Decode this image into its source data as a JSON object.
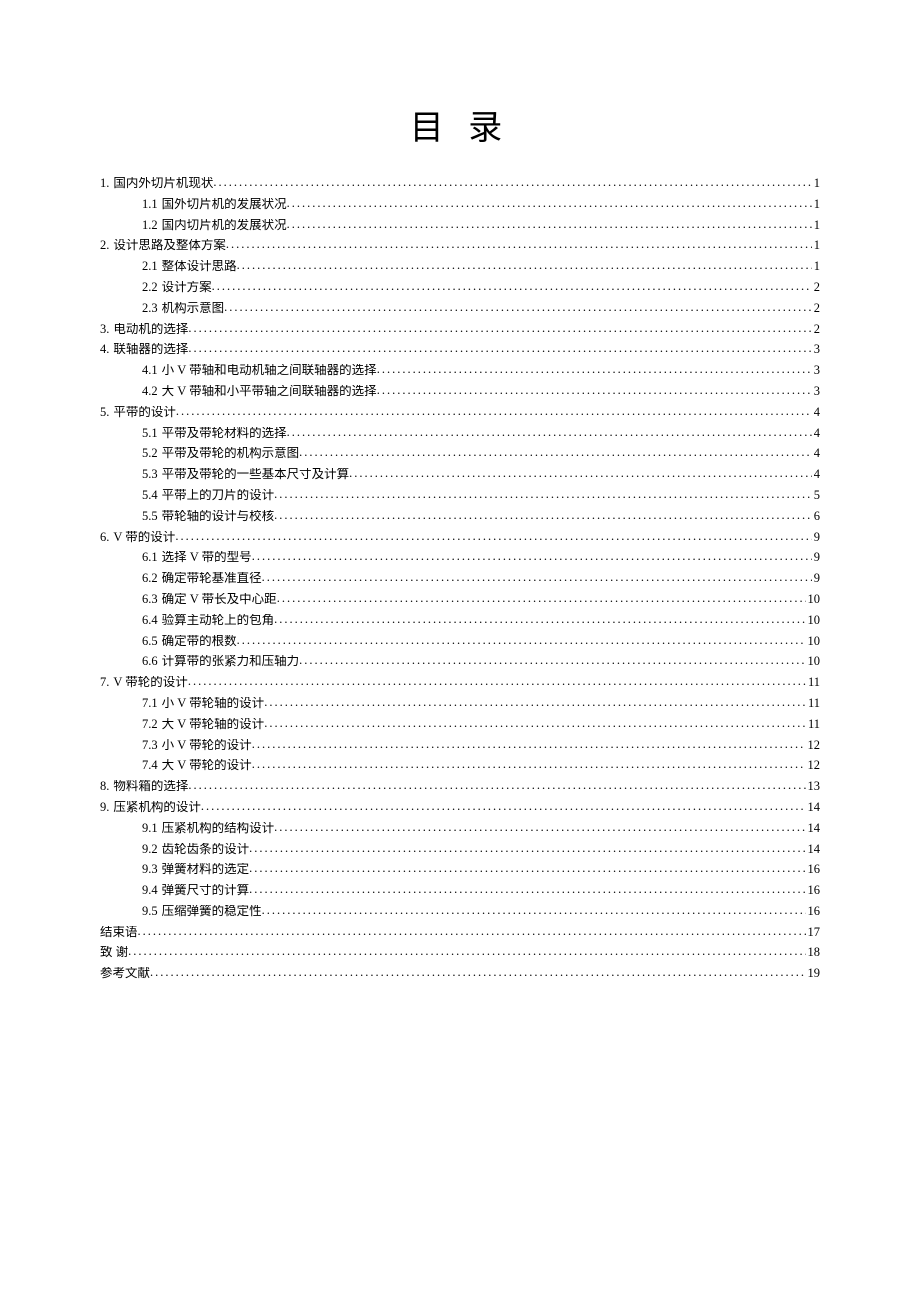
{
  "title": "目 录",
  "toc": [
    {
      "level": 1,
      "num": "1.",
      "text": "国内外切片机现状",
      "page": "1"
    },
    {
      "level": 2,
      "num": "1.1",
      "text": "国外切片机的发展状况",
      "page": "1"
    },
    {
      "level": 2,
      "num": "1.2",
      "text": "国内切片机的发展状况",
      "page": "1"
    },
    {
      "level": 1,
      "num": "2.",
      "text": "设计思路及整体方案",
      "page": "1"
    },
    {
      "level": 2,
      "num": "2.1",
      "text": "整体设计思路",
      "page": "1"
    },
    {
      "level": 2,
      "num": "2.2",
      "text": "设计方案",
      "page": "2"
    },
    {
      "level": 2,
      "num": "2.3",
      "text": "机构示意图",
      "page": "2"
    },
    {
      "level": 1,
      "num": "3.",
      "text": "电动机的选择",
      "page": "2"
    },
    {
      "level": 1,
      "num": "4.",
      "text": "联轴器的选择",
      "page": "3"
    },
    {
      "level": 2,
      "num": "4.1",
      "text": "小 V 带轴和电动机轴之间联轴器的选择",
      "page": "3"
    },
    {
      "level": 2,
      "num": "4.2",
      "text": "大 V 带轴和小平带轴之间联轴器的选择",
      "page": "3"
    },
    {
      "level": 1,
      "num": "5.",
      "text": "平带的设计",
      "page": "4"
    },
    {
      "level": 2,
      "num": "5.1",
      "text": "平带及带轮材料的选择",
      "page": "4"
    },
    {
      "level": 2,
      "num": "5.2",
      "text": "平带及带轮的机构示意图",
      "page": "4"
    },
    {
      "level": 2,
      "num": "5.3",
      "text": "平带及带轮的一些基本尺寸及计算",
      "page": "4"
    },
    {
      "level": 2,
      "num": "5.4",
      "text": "平带上的刀片的设计",
      "page": "5"
    },
    {
      "level": 2,
      "num": "5.5",
      "text": "带轮轴的设计与校核",
      "page": "6"
    },
    {
      "level": 1,
      "num": "6.",
      "text": "V 带的设计",
      "page": "9"
    },
    {
      "level": 2,
      "num": "6.1",
      "text": "选择 V 带的型号",
      "page": "9"
    },
    {
      "level": 2,
      "num": "6.2",
      "text": "确定带轮基准直径",
      "page": "9"
    },
    {
      "level": 2,
      "num": "6.3",
      "text": "确定 V 带长及中心距",
      "page": "10"
    },
    {
      "level": 2,
      "num": "6.4",
      "text": "验算主动轮上的包角",
      "page": "10"
    },
    {
      "level": 2,
      "num": "6.5",
      "text": "确定带的根数",
      "page": "10"
    },
    {
      "level": 2,
      "num": "6.6",
      "text": "计算带的张紧力和压轴力",
      "page": "10"
    },
    {
      "level": 1,
      "num": "7.",
      "text": "V 带轮的设计",
      "page": "11"
    },
    {
      "level": 2,
      "num": "7.1",
      "text": "小 V 带轮轴的设计",
      "page": "11"
    },
    {
      "level": 2,
      "num": "7.2",
      "text": "大 V 带轮轴的设计",
      "page": "11"
    },
    {
      "level": 2,
      "num": "7.3",
      "text": "小 V 带轮的设计",
      "page": "12"
    },
    {
      "level": 2,
      "num": "7.4",
      "text": "大 V 带轮的设计",
      "page": "12"
    },
    {
      "level": 1,
      "num": "8.",
      "text": "物料箱的选择",
      "page": "13"
    },
    {
      "level": 1,
      "num": "9.",
      "text": "压紧机构的设计",
      "page": "14"
    },
    {
      "level": 2,
      "num": "9.1",
      "text": "压紧机构的结构设计",
      "page": "14"
    },
    {
      "level": 2,
      "num": "9.2",
      "text": "齿轮齿条的设计",
      "page": "14"
    },
    {
      "level": 2,
      "num": "9.3",
      "text": "弹簧材料的选定",
      "page": "16"
    },
    {
      "level": 2,
      "num": "9.4",
      "text": "弹簧尺寸的计算",
      "page": "16"
    },
    {
      "level": 2,
      "num": "9.5",
      "text": "压缩弹簧的稳定性",
      "page": "16"
    },
    {
      "level": 1,
      "num": "",
      "text": "结束语",
      "page": "17"
    },
    {
      "level": 1,
      "num": "",
      "text": "致 谢",
      "page": "18"
    },
    {
      "level": 1,
      "num": "",
      "text": "参考文献",
      "page": "19"
    }
  ]
}
